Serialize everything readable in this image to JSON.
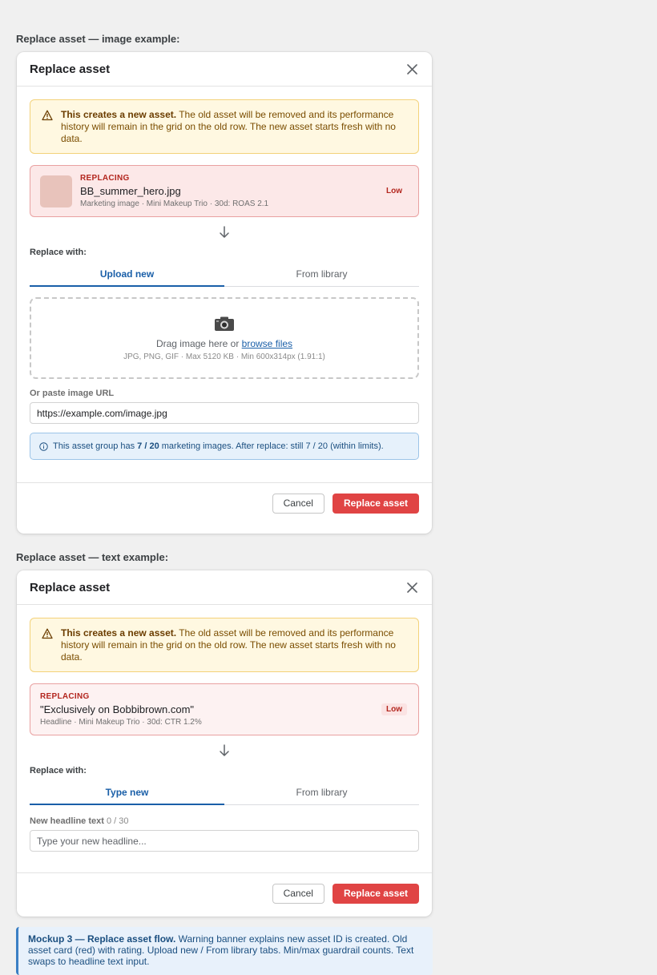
{
  "sections": {
    "image_label": "Replace asset — image example:",
    "text_label": "Replace asset — text example:"
  },
  "image_modal": {
    "title": "Replace asset",
    "warning_bold": "This creates a new asset.",
    "warning_rest": " The old asset will be removed and its performance history will remain in the grid on the old row. The new asset starts fresh with no data.",
    "replacing_tag": "REPLACING",
    "old_name": "BB_summer_hero.jpg",
    "old_meta": "Marketing image · Mini Makeup Trio · 30d: ROAS 2.1",
    "rating": "Low",
    "replace_with": "Replace with:",
    "tabs": [
      "Upload new",
      "From library"
    ],
    "drop_text": "Drag image here or ",
    "browse_link": "browse files",
    "drop_hint": "JPG, PNG, GIF · Max 5120 KB · Min 600x314px (1.91:1)",
    "url_label": "Or paste image URL",
    "url_value": "https://example.com/image.jpg",
    "info_pre": "This asset group has ",
    "info_bold": "7 / 20",
    "info_post": " marketing images. After replace: still 7 / 20 (within limits).",
    "cancel": "Cancel",
    "primary": "Replace asset"
  },
  "text_modal": {
    "title": "Replace asset",
    "warning_bold": "This creates a new asset.",
    "warning_rest": " The old asset will be removed and its performance history will remain in the grid on the old row. The new asset starts fresh with no data.",
    "replacing_tag": "REPLACING",
    "old_name": "\"Exclusively on Bobbibrown.com\"",
    "old_meta": "Headline · Mini Makeup Trio · 30d: CTR 1.2%",
    "rating": "Low",
    "replace_with": "Replace with:",
    "tabs": [
      "Type new",
      "From library"
    ],
    "field_label": "New headline text",
    "char_count": "0 / 30",
    "placeholder": "Type your new headline...",
    "cancel": "Cancel",
    "primary": "Replace asset"
  },
  "note": {
    "bold": "Mockup 3 — Replace asset flow.",
    "rest": " Warning banner explains new asset ID is created. Old asset card (red) with rating. Upload new / From library tabs. Min/max guardrail counts. Text swaps to headline text input."
  },
  "colors": {
    "primary_red": "#e04444",
    "accent_blue": "#1a5fa8",
    "warning_bg": "#fff8e1"
  },
  "icons": {
    "warning": "warning-triangle-icon",
    "close": "close-icon",
    "arrow": "arrow-down-icon",
    "camera": "camera-icon",
    "info": "info-icon"
  }
}
